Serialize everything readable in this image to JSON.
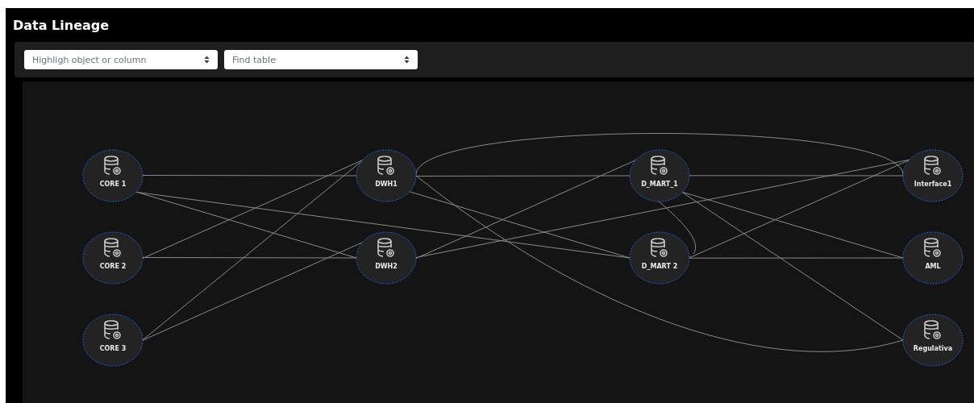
{
  "header": {
    "title": "Data Lineage"
  },
  "filters": [
    {
      "placeholder": "Highligh object or column"
    },
    {
      "placeholder": "Find table"
    }
  ],
  "graph": {
    "columns": [
      {
        "nodes": [
          {
            "label": "CORE 1"
          },
          {
            "label": "CORE 2"
          },
          {
            "label": "CORE 3"
          }
        ]
      },
      {
        "nodes": [
          {
            "label": "DWH1"
          },
          {
            "label": "DWH2"
          }
        ]
      },
      {
        "nodes": [
          {
            "label": "D_MART_1"
          },
          {
            "label": "D_MART 2"
          }
        ]
      },
      {
        "nodes": [
          {
            "label": "Interface1"
          },
          {
            "label": "AML"
          },
          {
            "label": "Regulativa"
          }
        ]
      }
    ]
  }
}
